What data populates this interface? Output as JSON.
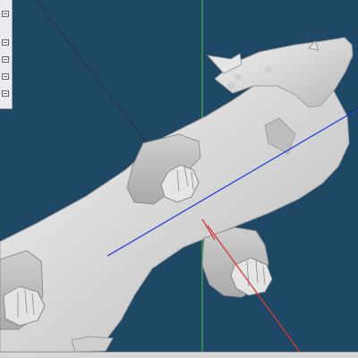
{
  "colors": {
    "viewport_background": "#1f4766",
    "x_axis": "#d23a3a",
    "y_axis": "#3f9d47",
    "z_axis": "#2545d6",
    "model_fill": "#d8d8d8",
    "panel_background": "#e9ebee"
  },
  "toolbar": {
    "icons": [
      "tool-icon",
      "tool-icon",
      "tool-icon",
      "tool-icon",
      "tool-icon"
    ]
  }
}
